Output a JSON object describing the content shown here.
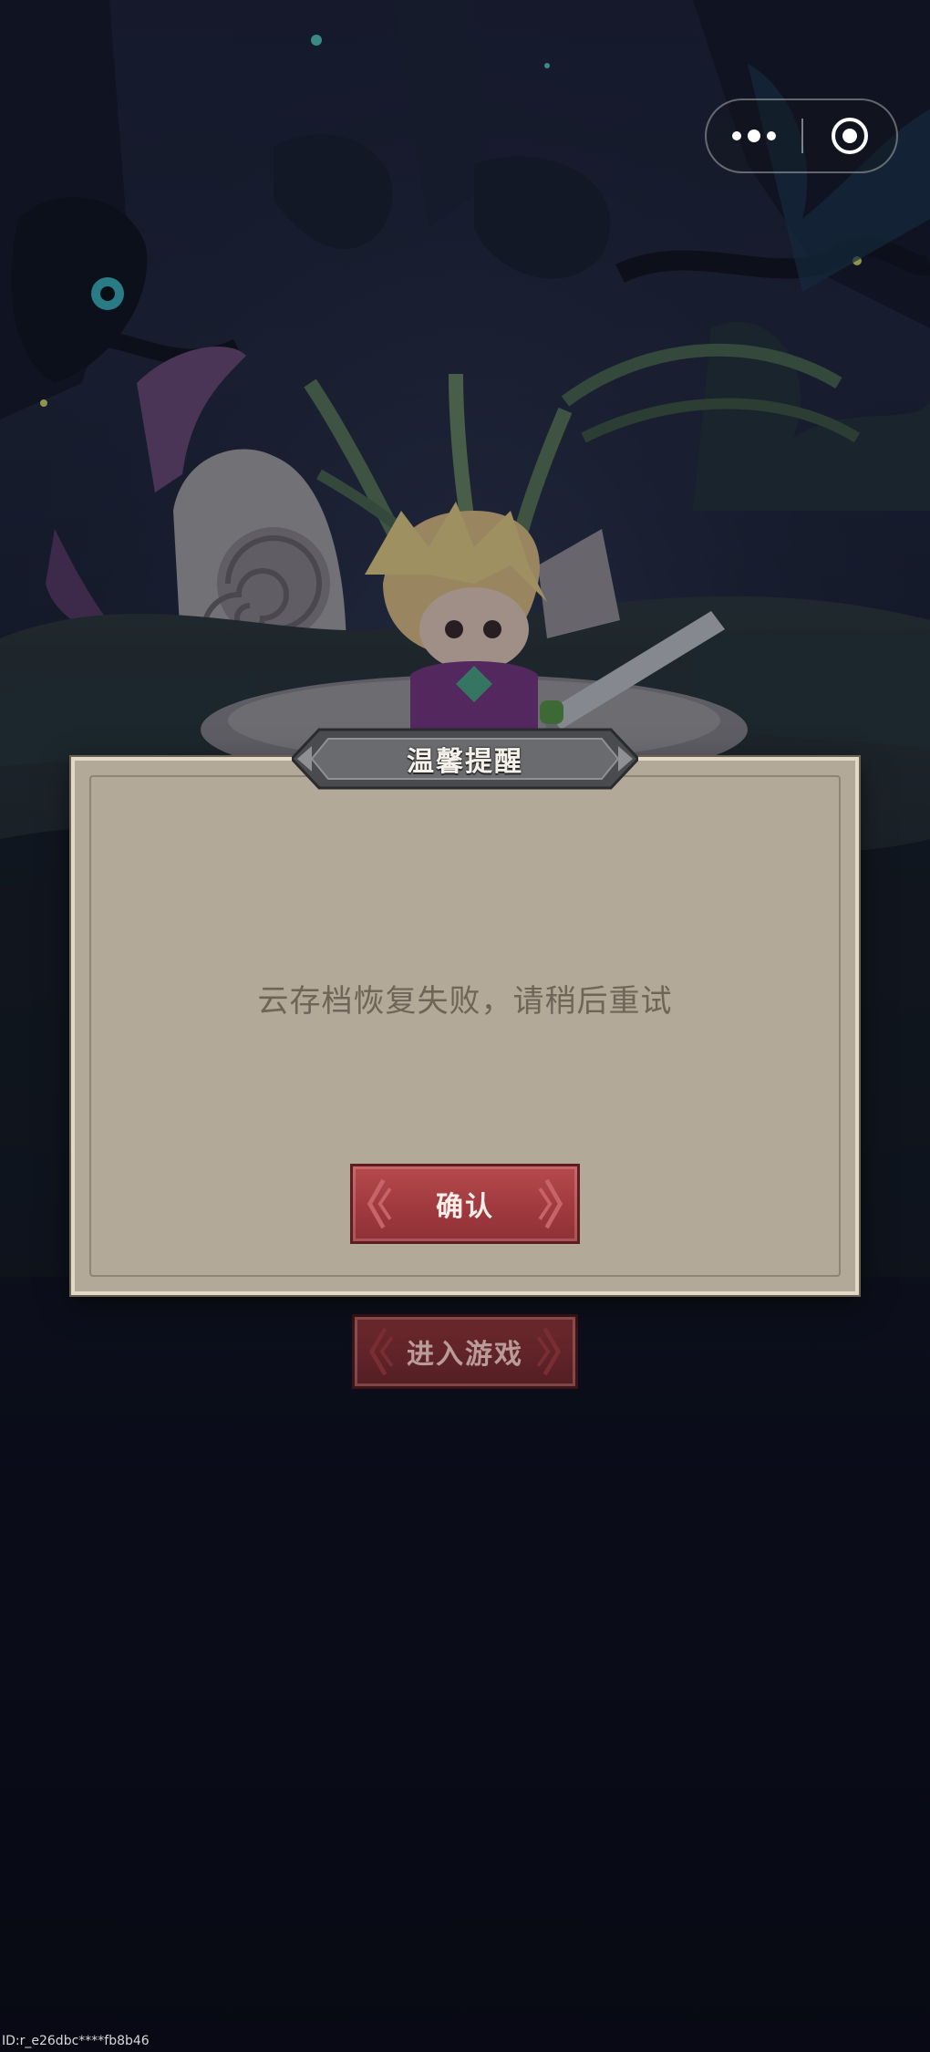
{
  "menu": {
    "more_icon": "more-dots-icon",
    "close_icon": "target-circle-icon"
  },
  "dialog": {
    "title": "温馨提醒",
    "message": "云存档恢复失败，请稍后重试",
    "confirm_label": "确认"
  },
  "main": {
    "enter_label": "进入游戏"
  },
  "footer": {
    "user_id": "ID:r_e26dbc****fb8b46"
  },
  "colors": {
    "dialog_bg": "#b3a998",
    "button_red": "#a03a3f",
    "message_text": "#6e6558"
  }
}
